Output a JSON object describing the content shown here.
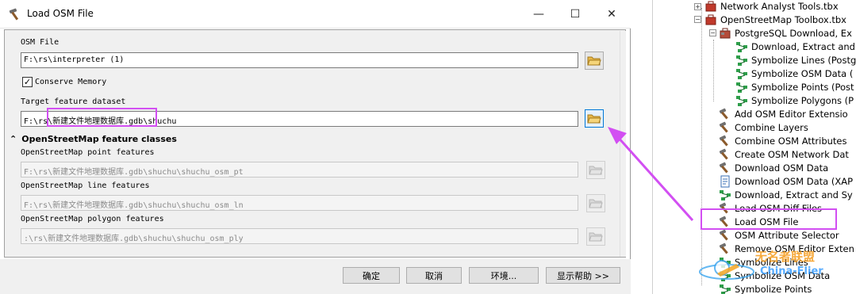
{
  "dialog": {
    "title": "Load OSM File",
    "osm_file_label": "OSM File",
    "osm_file_value": "F:\\rs\\interpreter (1)",
    "conserve_memory_label": "Conserve Memory",
    "conserve_memory_checked": "✓",
    "target_dataset_label": "Target feature dataset",
    "target_dataset_prefix": "F:\\rs\\",
    "target_dataset_highlight": "新建文件地理数据库.gdb",
    "target_dataset_suffix": "\\shuchu",
    "section_title": "OpenStreetMap feature classes",
    "section_chevron": "⌃",
    "point_label": "OpenStreetMap point features",
    "point_value": "F:\\rs\\新建文件地理数据库.gdb\\shuchu\\shuchu_osm_pt",
    "line_label": "OpenStreetMap line features",
    "line_value": "F:\\rs\\新建文件地理数据库.gdb\\shuchu\\shuchu_osm_ln",
    "polygon_label": "OpenStreetMap polygon features",
    "polygon_value": ":\\rs\\新建文件地理数据库.gdb\\shuchu\\shuchu_osm_ply",
    "buttons": {
      "ok": "确定",
      "cancel": "取消",
      "env": "环境...",
      "help": "显示帮助 >>"
    },
    "window_controls": {
      "minimize": "—",
      "maximize": "☐",
      "close": "✕"
    }
  },
  "toolbox_tree": {
    "items": [
      {
        "label": "Network Analyst Tools.tbx",
        "icon": "toolbox-icon"
      },
      {
        "label": "OpenStreetMap Toolbox.tbx",
        "icon": "toolbox-icon"
      },
      {
        "label": "PostgreSQL Download, Ex",
        "icon": "toolset-icon"
      },
      {
        "label": "Download, Extract and",
        "icon": "model-icon"
      },
      {
        "label": "Symbolize Lines (Postg",
        "icon": "model-icon"
      },
      {
        "label": "Symbolize OSM Data (",
        "icon": "model-icon"
      },
      {
        "label": "Symbolize Points (Post",
        "icon": "model-icon"
      },
      {
        "label": "Symbolize Polygons (P",
        "icon": "model-icon"
      },
      {
        "label": "Add OSM Editor Extensio",
        "icon": "hammer-icon"
      },
      {
        "label": "Combine Layers",
        "icon": "hammer-icon"
      },
      {
        "label": "Combine OSM Attributes",
        "icon": "hammer-icon"
      },
      {
        "label": "Create OSM Network Dat",
        "icon": "hammer-icon"
      },
      {
        "label": "Download OSM Data",
        "icon": "hammer-icon"
      },
      {
        "label": "Download OSM Data (XAP",
        "icon": "script-icon"
      },
      {
        "label": "Download, Extract and Sy",
        "icon": "model-icon"
      },
      {
        "label": "Load OSM Diff Files",
        "icon": "hammer-icon"
      },
      {
        "label": "Load OSM File",
        "icon": "hammer-icon"
      },
      {
        "label": "OSM Attribute Selector",
        "icon": "hammer-icon"
      },
      {
        "label": "Remove OSM Editor Exten",
        "icon": "hammer-icon"
      },
      {
        "label": "Symbolize Lines",
        "icon": "model-icon"
      },
      {
        "label": "Symbolize OSM Data",
        "icon": "model-icon"
      },
      {
        "label": "Symbolize Points",
        "icon": "model-icon"
      }
    ]
  },
  "watermark": {
    "text_cn": "无名者联盟",
    "text_en": "China-Flier"
  },
  "colors": {
    "highlight": "#d24ff2",
    "focus": "#0078d7",
    "dialog_bg": "#f0f0f0"
  }
}
